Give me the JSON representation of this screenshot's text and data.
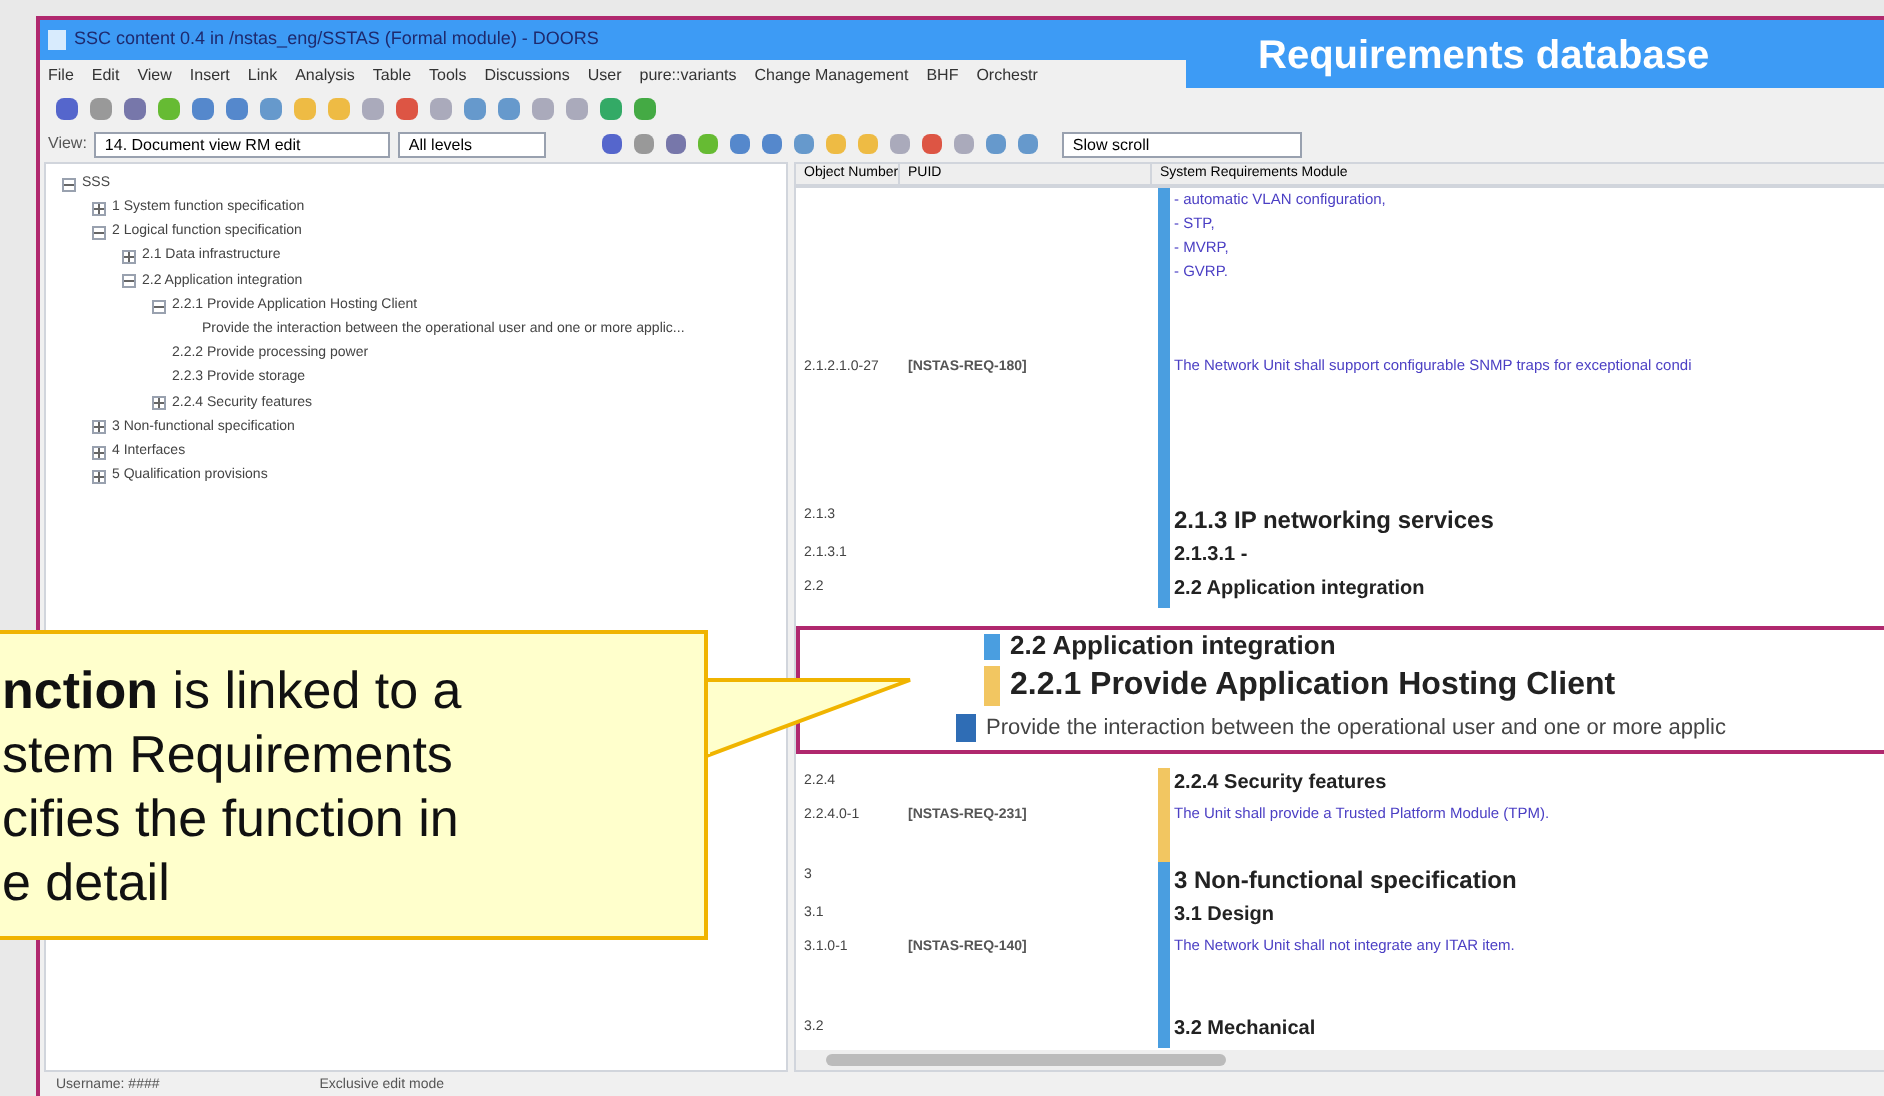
{
  "window": {
    "title": "SSC content 0.4 in /nstas_eng/SSTAS (Formal module) - DOORS"
  },
  "menu": [
    "File",
    "Edit",
    "View",
    "Insert",
    "Link",
    "Analysis",
    "Table",
    "Tools",
    "Discussions",
    "User",
    "pure::variants",
    "Change Management",
    "BHF",
    "Orchestr"
  ],
  "view_bar": {
    "label": "View:",
    "view": "14. Document view RM edit",
    "levels": "All levels",
    "scroll": "Slow scroll"
  },
  "tree": [
    {
      "label": "SSS",
      "expanded": true,
      "children": [
        {
          "label": "1 System function specification",
          "expanded": false
        },
        {
          "label": "2 Logical function specification",
          "expanded": true,
          "children": [
            {
              "label": "2.1 Data infrastructure",
              "expanded": false
            },
            {
              "label": "2.2 Application integration",
              "expanded": true,
              "children": [
                {
                  "label": "2.2.1 Provide Application Hosting Client",
                  "expanded": true,
                  "children": [
                    {
                      "label": "Provide the interaction between the operational user and one or more applic..."
                    }
                  ]
                },
                {
                  "label": "2.2.2 Provide processing power"
                },
                {
                  "label": "2.2.3 Provide storage"
                },
                {
                  "label": "2.2.4 Security features",
                  "expanded": false
                }
              ]
            }
          ]
        },
        {
          "label": "3 Non-functional specification",
          "expanded": false
        },
        {
          "label": "4 Interfaces",
          "expanded": false
        },
        {
          "label": "5 Qualification provisions",
          "expanded": false
        }
      ]
    }
  ],
  "table": {
    "columns": [
      "Object Number",
      "PUID",
      "System Requirements Module"
    ],
    "rows": [
      {
        "kind": "list",
        "number": "",
        "puid": "",
        "color": "#4a9ee0",
        "lines": [
          "- automatic VLAN configuration,",
          "- STP,",
          "- MVRP,",
          "- GVRP."
        ]
      },
      {
        "kind": "text",
        "number": "2.1.2.1.0-27",
        "puid": "[NSTAS-REQ-180]",
        "color": "#4a9ee0",
        "lines": [
          "The Network Unit shall support configurable SNMP traps for exceptional condi"
        ]
      },
      {
        "kind": "heading",
        "number": "2.1.3",
        "puid": "",
        "color": "#4a9ee0",
        "lines": [
          "2.1.3 IP networking services"
        ]
      },
      {
        "kind": "subheading",
        "number": "2.1.3.1",
        "puid": "",
        "color": "#4a9ee0",
        "lines": [
          "2.1.3.1 -"
        ]
      },
      {
        "kind": "subheading",
        "number": "2.2",
        "puid": "",
        "color": "#4a9ee0",
        "lines": [
          "2.2 Application integration"
        ]
      },
      {
        "kind": "gap"
      },
      {
        "kind": "subheading",
        "number": "2.2.4",
        "puid": "",
        "color": "#f2c661",
        "lines": [
          "2.2.4 Security features"
        ]
      },
      {
        "kind": "text",
        "number": "2.2.4.0-1",
        "puid": "[NSTAS-REQ-231]",
        "color": "#f2c661",
        "lines": [
          "The Unit shall provide a Trusted Platform Module (TPM)."
        ]
      },
      {
        "kind": "heading",
        "number": "3",
        "puid": "",
        "color": "#4a9ee0",
        "lines": [
          "3 Non-functional specification"
        ]
      },
      {
        "kind": "subheading",
        "number": "3.1",
        "puid": "",
        "color": "#4a9ee0",
        "lines": [
          "3.1 Design"
        ]
      },
      {
        "kind": "text",
        "number": "3.1.0-1",
        "puid": "[NSTAS-REQ-140]",
        "color": "#4a9ee0",
        "lines": [
          "The Network Unit shall not integrate any ITAR item."
        ]
      },
      {
        "kind": "subheading",
        "number": "3.2",
        "puid": "",
        "color": "#4a9ee0",
        "lines": [
          "3.2 Mechanical"
        ]
      }
    ]
  },
  "status_bar": [
    "Username: ####",
    "Exclusive edit mode"
  ],
  "banner": "Requirements database",
  "inset": [
    {
      "kind": "cut",
      "color": "#4a9ee0",
      "text": "2.2 Application integration"
    },
    {
      "kind": "heading",
      "color": "#f2c661",
      "text": "2.2.1 Provide Application Hosting Client"
    },
    {
      "kind": "text",
      "color": "#2f6db5",
      "text": "Provide the interaction between the operational user and one or more applic"
    }
  ],
  "callout": [
    "**nction** is linked to a",
    "stem Requirements",
    "cifies the function in",
    "e detail"
  ]
}
